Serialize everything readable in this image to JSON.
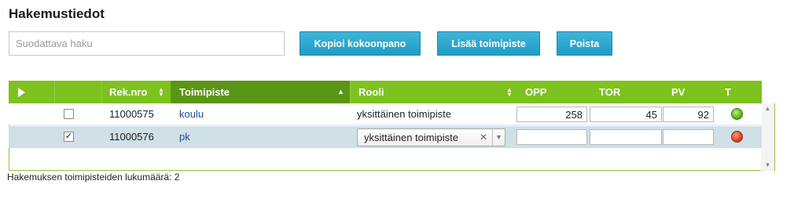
{
  "page": {
    "title": "Hakemustiedot"
  },
  "search": {
    "placeholder": "Suodattava haku",
    "value": ""
  },
  "toolbar": {
    "copy_label": "Kopioi kokoonpano",
    "add_label": "Lisää toimipiste",
    "remove_label": "Poista"
  },
  "grid": {
    "columns": {
      "rek_nro": "Rek.nro",
      "toimipiste": "Toimipiste",
      "rooli": "Rooli",
      "opp": "OPP",
      "tor": "TOR",
      "pv": "PV",
      "t": "T"
    },
    "rows": [
      {
        "checked": false,
        "rek_nro": "11000575",
        "toimipiste": "koulu",
        "rooli": "yksittäinen toimipiste",
        "opp": "258",
        "tor": "45",
        "pv": "92",
        "status": "green"
      },
      {
        "checked": true,
        "rek_nro": "11000576",
        "toimipiste": "pk",
        "rooli": "yksittäinen toimipiste",
        "opp": "",
        "tor": "",
        "pv": "",
        "status": "red"
      }
    ]
  },
  "footer": {
    "count_text": "Hakemuksen toimipisteiden lukumäärä: 2"
  },
  "colors": {
    "header_green": "#7dc21e",
    "sorted_header": "#5a9616",
    "button_blue": "#2aa9d3",
    "selected_row": "#cfe0e6"
  }
}
